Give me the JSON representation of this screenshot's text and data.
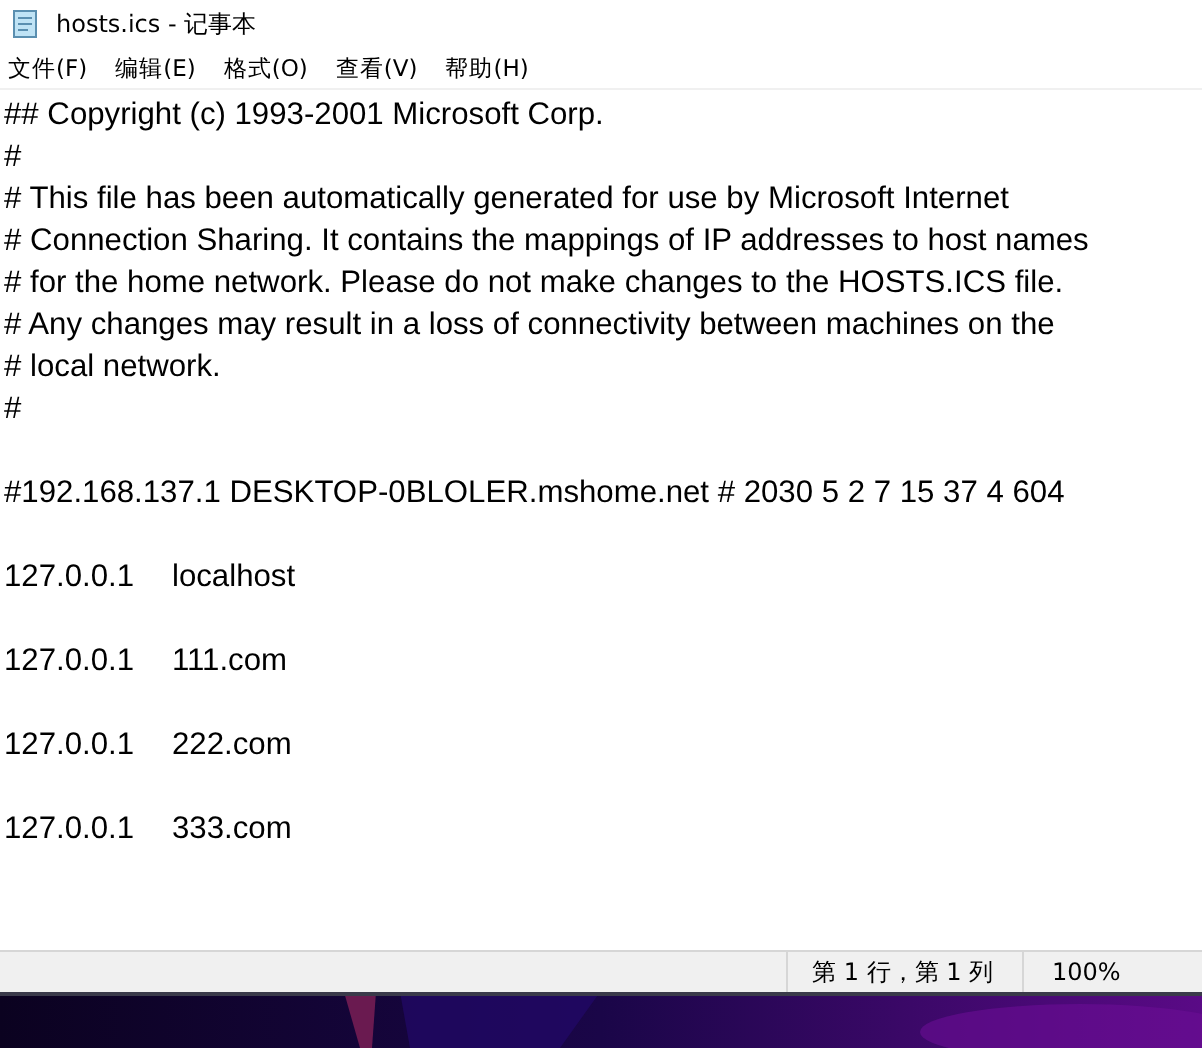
{
  "window": {
    "title": "hosts.ics - 记事本"
  },
  "menu": [
    "文件(F)",
    "编辑(E)",
    "格式(O)",
    "查看(V)",
    "帮助(H)"
  ],
  "editor": {
    "blocks": [
      [
        "## Copyright (c) 1993-2001 Microsoft Corp.",
        "#",
        "# This file has been automatically generated for use by Microsoft Internet",
        "# Connection Sharing. It contains the mappings of IP addresses to host names",
        "# for the home network. Please do not make changes to the HOSTS.ICS file.",
        "# Any changes may result in a loss of connectivity between machines on the",
        "# local network.",
        "#"
      ],
      [
        "#192.168.137.1 DESKTOP-0BLOLER.mshome.net # 2030 5 2 7 15 37 4 604"
      ],
      [
        "127.0.0.1\tlocalhost"
      ],
      [
        "127.0.0.1\t111.com"
      ],
      [
        "127.0.0.1\t222.com"
      ],
      [
        "127.0.0.1\t333.com"
      ]
    ]
  },
  "status_bar": {
    "position": "第 1 行，第 1 列",
    "zoom": "100%"
  },
  "desktop": {
    "kind": "picture"
  }
}
